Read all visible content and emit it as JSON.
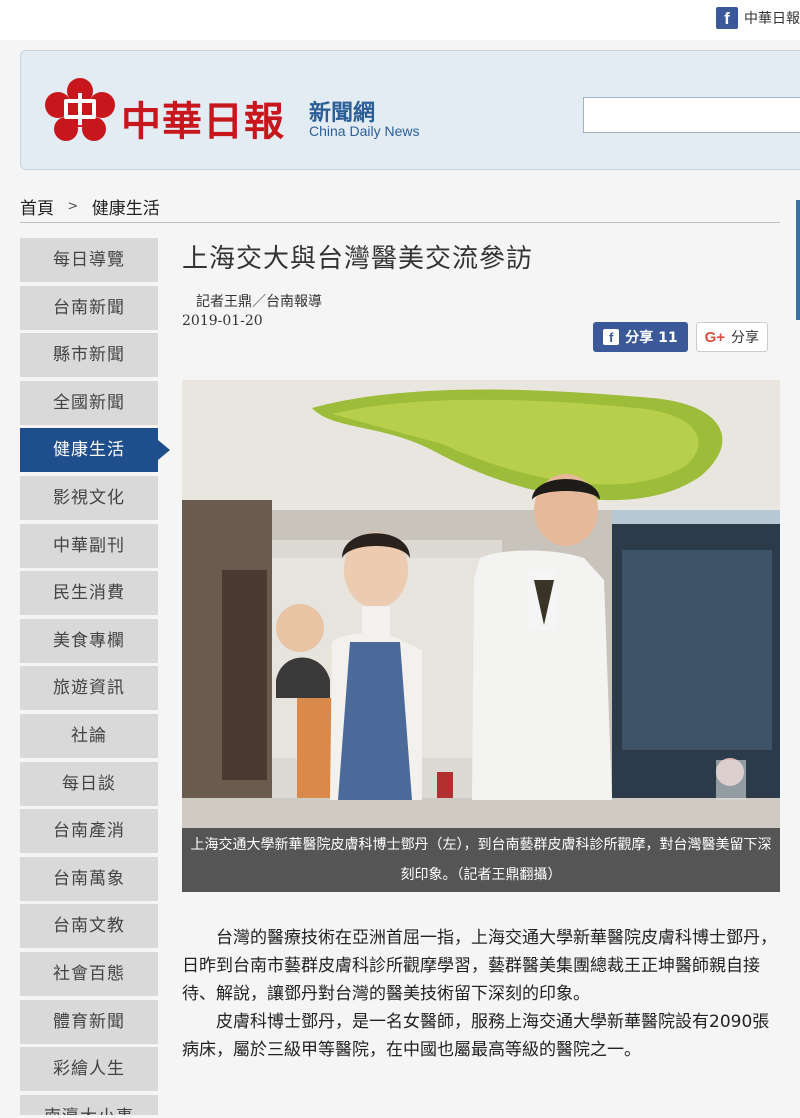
{
  "topbar": {
    "fb_label": "中華日報"
  },
  "header": {
    "brand_zh": "中華日報",
    "brand_news": "新聞網",
    "brand_en": "China Daily News",
    "search_placeholder": ""
  },
  "breadcrumb": {
    "home": "首頁",
    "separator": ">",
    "current": "健康生活"
  },
  "sidebar": {
    "items": [
      {
        "label": "每日導覽"
      },
      {
        "label": "台南新聞"
      },
      {
        "label": "縣市新聞"
      },
      {
        "label": "全國新聞"
      },
      {
        "label": "健康生活",
        "active": true
      },
      {
        "label": "影視文化"
      },
      {
        "label": "中華副刊"
      },
      {
        "label": "民生消費"
      },
      {
        "label": "美食專欄"
      },
      {
        "label": "旅遊資訊"
      },
      {
        "label": "社論"
      },
      {
        "label": "每日談"
      },
      {
        "label": "台南產消"
      },
      {
        "label": "台南萬象"
      },
      {
        "label": "台南文教"
      },
      {
        "label": "社會百態"
      },
      {
        "label": "體育新聞"
      },
      {
        "label": "彩繪人生"
      },
      {
        "label": "南瀛大小事"
      }
    ]
  },
  "article": {
    "title": "上海交大與台灣醫美交流參訪",
    "byline": "記者王鼎／台南報導",
    "date": "2019-01-20",
    "share_fb": "分享 11",
    "share_gplus": "分享",
    "caption": "上海交通大學新華醫院皮膚科博士鄧丹（左），到台南藝群皮膚科診所觀摩，對台灣醫美留下深刻印象。（記者王鼎翻攝）",
    "paragraphs": [
      "台灣的醫療技術在亞洲首屈一指，上海交通大學新華醫院皮膚科博士鄧丹，日昨到台南市藝群皮膚科診所觀摩學習，藝群醫美集團總裁王正坤醫師親自接待、解說，讓鄧丹對台灣的醫美技術留下深刻的印象。",
      "皮膚科博士鄧丹，是一名女醫師，服務上海交通大學新華醫院設有2090張病床，屬於三級甲等醫院，在中國也屬最高等級的醫院之一。"
    ]
  },
  "icons": {
    "facebook": "facebook-icon",
    "gplus": "google-plus-icon",
    "logo": "plum-blossom-logo"
  },
  "colors": {
    "brand_red": "#c8161d",
    "brand_blue": "#2d5f97",
    "nav_active": "#1f4e8c",
    "fb_blue": "#3b5998"
  }
}
